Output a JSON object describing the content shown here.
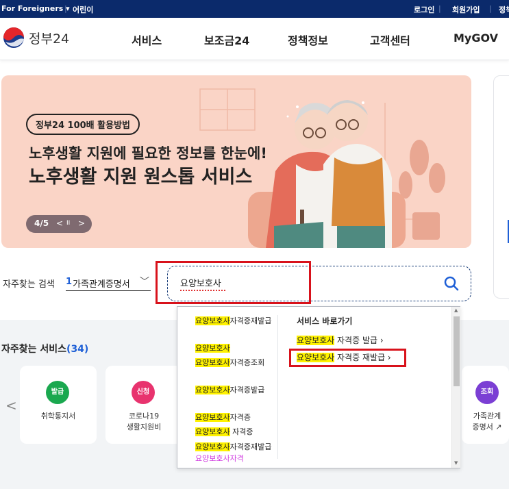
{
  "util_bar": {
    "for_foreigners": "For Foreigners ▾",
    "kids": "어린이",
    "login": "로그인",
    "signup": "회원가입",
    "cut": "정책"
  },
  "header": {
    "logo": "정부24",
    "nav": [
      "서비스",
      "보조금24",
      "정책정보",
      "고객센터",
      "MyGOV"
    ]
  },
  "banner": {
    "tag": "정부24 100배 활용방법",
    "subtitle": "노후생활 지원에 필요한 정보를 한눈에!",
    "title": "노후생활 지원 원스톱 서비스",
    "pager": {
      "current": "4/5",
      "prev": "<",
      "pause": "II",
      "next": ">"
    }
  },
  "search": {
    "frequent_label": "자주찾는 검색",
    "frequent_rank": "1",
    "frequent_item": "가족관계증명서",
    "query": "요양보호사"
  },
  "autocomplete": {
    "suggestions": [
      {
        "hl": "요양보호사",
        "rest": "자격증재발급",
        "rest_hl": ""
      },
      {
        "hl": "요양보호사",
        "rest": "",
        "rest_hl": ""
      },
      {
        "hl": "요양보호사",
        "rest": "자격증조회",
        "rest_hl": ""
      },
      {
        "hl": "요양보호사",
        "rest": "자격증발급",
        "rest_hl": ""
      },
      {
        "hl": "요양보호사",
        "rest": "자격증",
        "rest_hl": ""
      },
      {
        "hl": "요양보호사",
        "rest": " 자격증",
        "rest_hl": ""
      },
      {
        "hl": "요양보호사",
        "rest": "자격증재발급 ",
        "rest_hl": "요양보호사자격"
      }
    ],
    "shortcut_title": "서비스 바로가기",
    "shortcuts": [
      {
        "hl": "요양보호사",
        "rest": " 자격증 발급  ›"
      },
      {
        "hl": "요양보호사",
        "rest": " 자격증 재발급  ›"
      }
    ]
  },
  "services": {
    "title": "자주찾는 서비스",
    "count": "(34)",
    "prev": "<",
    "cards": [
      {
        "badge": "발급",
        "color": "#1aa84f",
        "name": "취학통지서"
      },
      {
        "badge": "신청",
        "color": "#e8336e",
        "name": "코로나19\n생활지원비"
      },
      {
        "badge": "조회",
        "color": "#7b3fd4",
        "name": "가족관계\n증명서 ↗"
      }
    ]
  },
  "colors": {
    "brand_navy": "#0b2a6b",
    "accent_blue": "#1e5fd6",
    "annotation_red": "#d8121b",
    "highlight_yellow": "#fff200",
    "banner_bg": "#fad4c6"
  }
}
